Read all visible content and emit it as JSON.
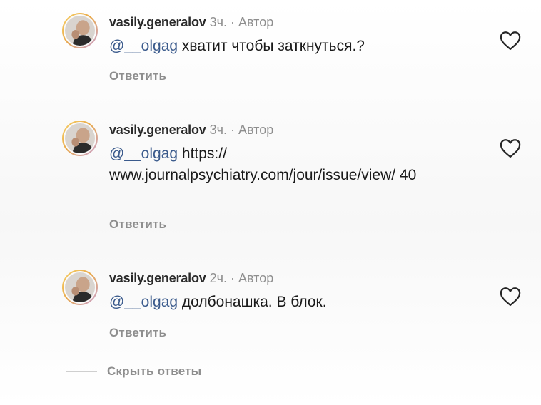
{
  "comments": [
    {
      "username": "vasily.generalov",
      "time": "3ч.",
      "separator": "·",
      "author_label": "Автор",
      "mention": "@__olgag",
      "body": " хватит чтобы заткнуться.?",
      "reply_label": "Ответить"
    },
    {
      "username": "vasily.generalov",
      "time": "3ч.",
      "separator": "·",
      "author_label": "Автор",
      "mention": "@__olgag",
      "body": " https:// www.journalpsychiatry.com/jour/issue/view/ 40",
      "reply_label": "Ответить"
    },
    {
      "username": "vasily.generalov",
      "time": "2ч.",
      "separator": "·",
      "author_label": "Автор",
      "mention": "@__olgag",
      "body": " долбонашка. В блок.",
      "reply_label": "Ответить"
    }
  ],
  "hide_replies_label": "Скрыть ответы",
  "icons": {
    "like": "heart-outline-icon",
    "avatar": "profile-photo"
  },
  "colors": {
    "mention": "#3a5a8c",
    "secondary_text": "#8e8e8e",
    "avatar_ring": "#e9a94a"
  }
}
